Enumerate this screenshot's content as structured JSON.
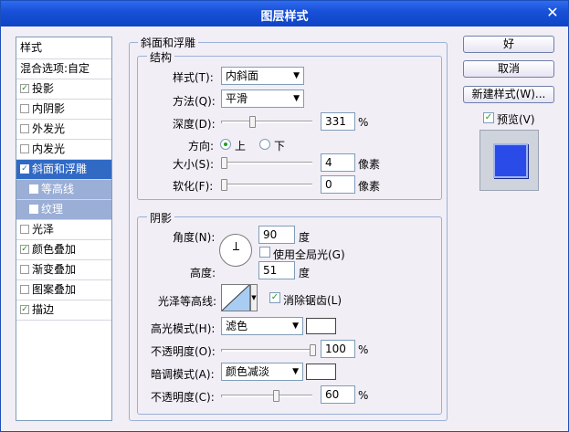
{
  "window": {
    "title": "图层样式",
    "close": "✕"
  },
  "styles_list": {
    "header": "样式",
    "items": [
      {
        "label": "混合选项:自定",
        "checkbox": false,
        "checked": false
      },
      {
        "label": "投影",
        "checkbox": true,
        "checked": true
      },
      {
        "label": "内阴影",
        "checkbox": true,
        "checked": false
      },
      {
        "label": "外发光",
        "checkbox": true,
        "checked": false
      },
      {
        "label": "内发光",
        "checkbox": true,
        "checked": false
      },
      {
        "label": "斜面和浮雕",
        "checkbox": true,
        "checked": true
      },
      {
        "label": "等高线",
        "checkbox": true,
        "checked": false
      },
      {
        "label": "纹理",
        "checkbox": true,
        "checked": false
      },
      {
        "label": "光泽",
        "checkbox": true,
        "checked": false
      },
      {
        "label": "颜色叠加",
        "checkbox": true,
        "checked": true
      },
      {
        "label": "渐变叠加",
        "checkbox": true,
        "checked": false
      },
      {
        "label": "图案叠加",
        "checkbox": true,
        "checked": false
      },
      {
        "label": "描边",
        "checkbox": true,
        "checked": true
      }
    ]
  },
  "bevel": {
    "group_title": "斜面和浮雕",
    "structure_title": "结构",
    "style_label": "样式(T):",
    "style_value": "内斜面",
    "technique_label": "方法(Q):",
    "technique_value": "平滑",
    "depth_label": "深度(D):",
    "depth_value": "331",
    "depth_unit": "%",
    "direction_label": "方向:",
    "direction_up": "上",
    "direction_down": "下",
    "size_label": "大小(S):",
    "size_value": "4",
    "size_unit": "像素",
    "soften_label": "软化(F):",
    "soften_value": "0",
    "soften_unit": "像素"
  },
  "shading": {
    "title": "阴影",
    "angle_label": "角度(N):",
    "angle_value": "90",
    "angle_unit": "度",
    "global_light_label": "使用全局光(G)",
    "altitude_label": "高度:",
    "altitude_value": "51",
    "altitude_unit": "度",
    "gloss_contour_label": "光泽等高线:",
    "anti_alias_label": "消除锯齿(L)",
    "highlight_mode_label": "高光模式(H):",
    "highlight_mode_value": "滤色",
    "highlight_opacity_label": "不透明度(O):",
    "highlight_opacity_value": "100",
    "shadow_mode_label": "暗调模式(A):",
    "shadow_mode_value": "颜色减淡",
    "shadow_opacity_label": "不透明度(C):",
    "shadow_opacity_value": "60",
    "unit_percent": "%"
  },
  "buttons": {
    "ok": "好",
    "cancel": "取消",
    "new_style": "新建样式(W)...",
    "preview": "预览(V)"
  },
  "colors": {
    "accent": "#316ac5",
    "preview_fill": "#2b4be8",
    "title_bar": "#1851d8"
  }
}
